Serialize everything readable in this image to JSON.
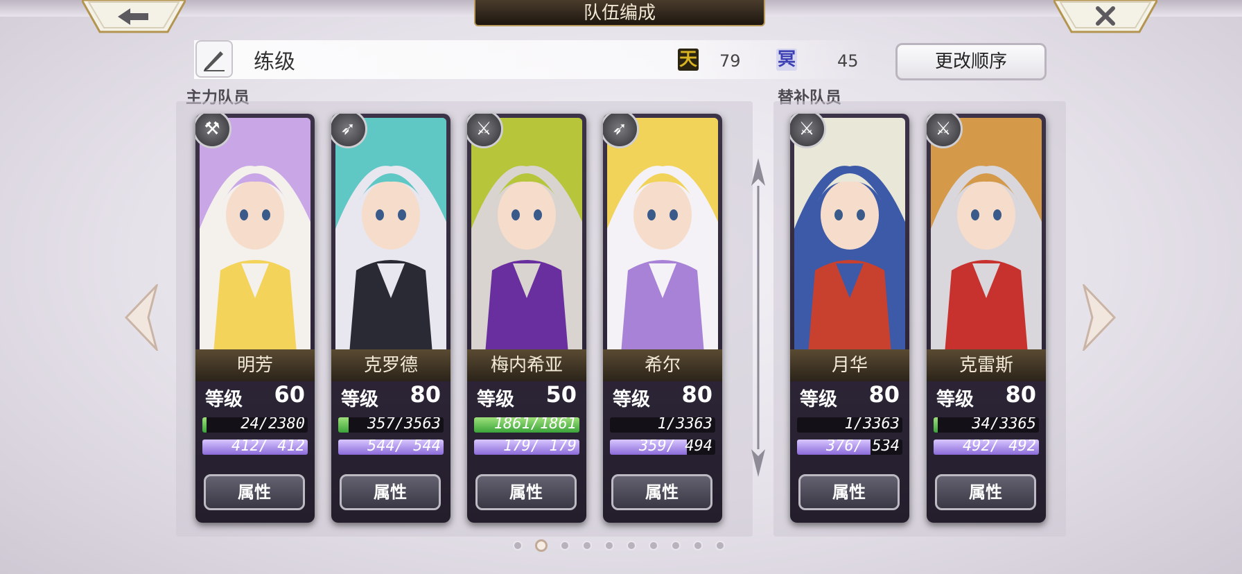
{
  "header": {
    "title": "队伍编成"
  },
  "info": {
    "label": "练级",
    "resource1_icon": "天",
    "resource1_value": "79",
    "resource2_icon": "冥",
    "resource2_value": "45",
    "reorder_label": "更改顺序"
  },
  "sections": {
    "main_label": "主力队员",
    "sub_label": "替补队员"
  },
  "cards": [
    {
      "name": "明芳",
      "level_label": "等级",
      "level": "60",
      "hp_text": "24/2380",
      "hp_fill": 0.01,
      "mp_text": "412/ 412",
      "mp_fill": 1.0,
      "attr_label": "属性",
      "weapon": "axe-icon",
      "palette": [
        "#c9a7e6",
        "#f3d35a",
        "#f4f0ec"
      ]
    },
    {
      "name": "克罗德",
      "level_label": "等级",
      "level": "80",
      "hp_text": "357/3563",
      "hp_fill": 0.1,
      "mp_text": "544/ 544",
      "mp_fill": 1.0,
      "attr_label": "属性",
      "weapon": "bow-icon",
      "palette": [
        "#5fc7c4",
        "#2a2a35",
        "#e8e6ef"
      ]
    },
    {
      "name": "梅内希亚",
      "level_label": "等级",
      "level": "50",
      "hp_text": "1861/1861",
      "hp_fill": 1.0,
      "mp_text": "179/ 179",
      "mp_fill": 1.0,
      "attr_label": "属性",
      "weapon": "sword-icon",
      "palette": [
        "#b7c53a",
        "#6a2f9e",
        "#d9d4d0"
      ]
    },
    {
      "name": "希尔",
      "level_label": "等级",
      "level": "80",
      "hp_text": "1/3363",
      "hp_fill": 0.0,
      "mp_text": "359/ 494",
      "mp_fill": 0.73,
      "attr_label": "属性",
      "weapon": "bow-icon",
      "palette": [
        "#f2d35a",
        "#a882d6",
        "#f4f2f6"
      ]
    },
    {
      "name": "月华",
      "level_label": "等级",
      "level": "80",
      "hp_text": "1/3363",
      "hp_fill": 0.0,
      "mp_text": "376/ 534",
      "mp_fill": 0.7,
      "attr_label": "属性",
      "weapon": "katana-icon",
      "palette": [
        "#e9e7d8",
        "#c8402e",
        "#3d5aa8"
      ]
    },
    {
      "name": "克雷斯",
      "level_label": "等级",
      "level": "80",
      "hp_text": "34/3365",
      "hp_fill": 0.01,
      "mp_text": "492/ 492",
      "mp_fill": 1.0,
      "attr_label": "属性",
      "weapon": "sword-icon",
      "palette": [
        "#d49a4a",
        "#c8322e",
        "#d9d6dc"
      ]
    }
  ],
  "pager": {
    "count": 10,
    "active_index": 1
  }
}
